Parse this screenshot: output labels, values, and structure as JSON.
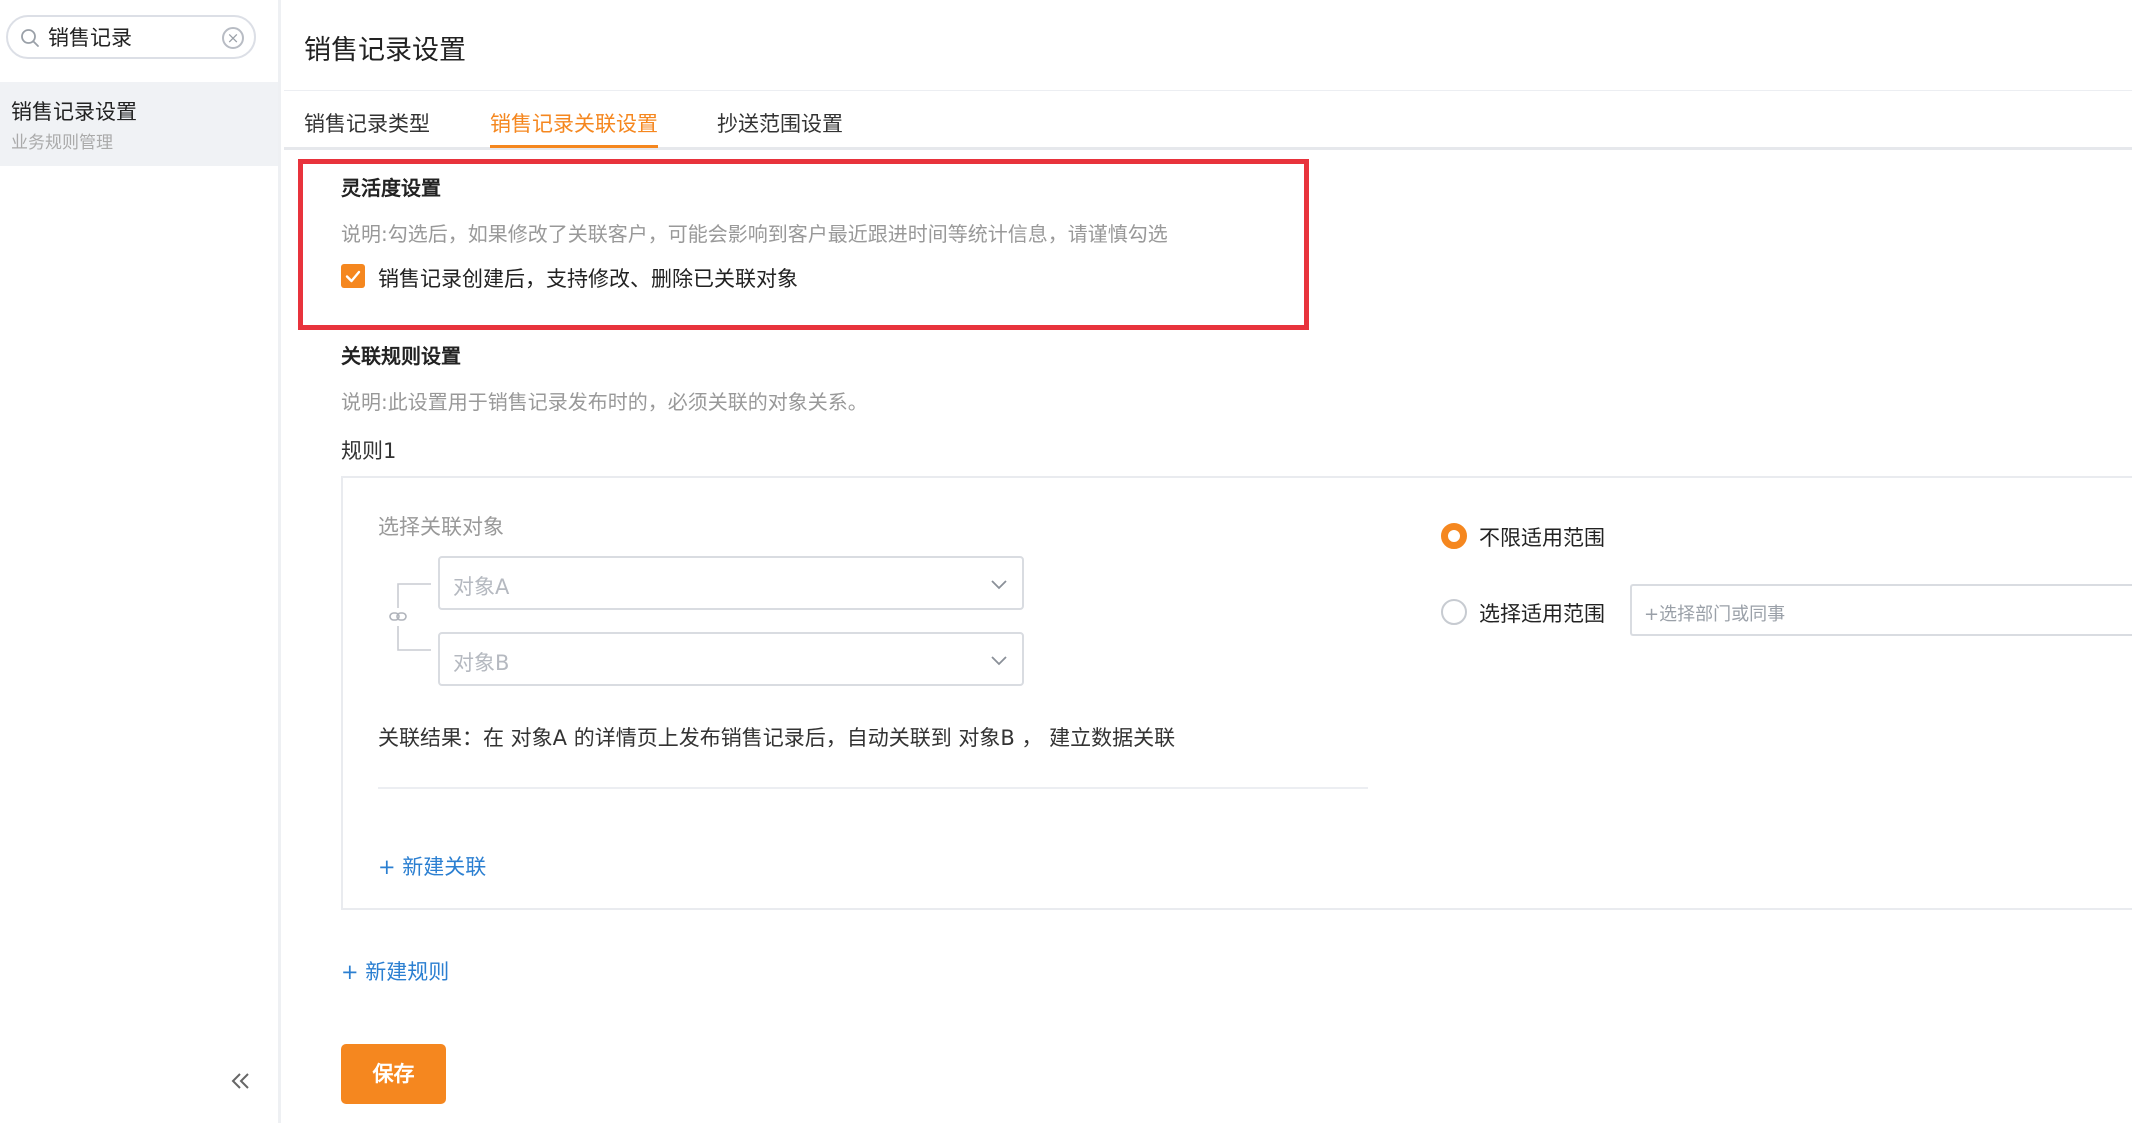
{
  "sidebar": {
    "search": {
      "value": "销售记录",
      "clear_icon": "clear-icon"
    },
    "items": [
      {
        "label": "销售记录设置",
        "sublabel": "业务规则管理"
      }
    ]
  },
  "page": {
    "title": "销售记录设置"
  },
  "tabs": [
    {
      "label": "销售记录类型",
      "active": false
    },
    {
      "label": "销售记录关联设置",
      "active": true
    },
    {
      "label": "抄送范围设置",
      "active": false
    }
  ],
  "flexibility": {
    "title": "灵活度设置",
    "description": "说明:勾选后，如果修改了关联客户，可能会影响到客户最近跟进时间等统计信息，请谨慎勾选",
    "checkbox_label": "销售记录创建后，支持修改、删除已关联对象",
    "checked": true
  },
  "association_rules": {
    "title": "关联规则设置",
    "description": "说明:此设置用于销售记录发布时的，必须关联的对象关系。",
    "rules": [
      {
        "label": "规则1",
        "field_label": "选择关联对象",
        "object_a_placeholder": "对象A",
        "object_b_placeholder": "对象B",
        "result_text": "关联结果：在 对象A 的详情页上发布销售记录后，自动关联到 对象B ， 建立数据关联",
        "add_association": "+ 新建关联",
        "scope_options": [
          {
            "label": "不限适用范围",
            "selected": true
          },
          {
            "label": "选择适用范围",
            "selected": false
          }
        ],
        "scope_placeholder": "+选择部门或同事"
      }
    ],
    "add_rule": "+ 新建规则"
  },
  "save_label": "保存",
  "colors": {
    "accent": "#f5871f",
    "link": "#2b7fd1",
    "highlight_frame": "#e8333c"
  },
  "icons": [
    "search-icon",
    "clear-icon",
    "chevron-down-icon",
    "link-icon",
    "check-icon",
    "collapse-icon"
  ]
}
